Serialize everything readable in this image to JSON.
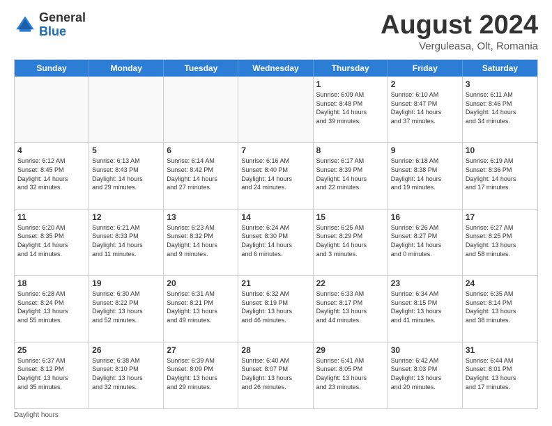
{
  "header": {
    "logo_general": "General",
    "logo_blue": "Blue",
    "month_title": "August 2024",
    "location": "Verguleasa, Olt, Romania"
  },
  "days_of_week": [
    "Sunday",
    "Monday",
    "Tuesday",
    "Wednesday",
    "Thursday",
    "Friday",
    "Saturday"
  ],
  "footer_note": "Daylight hours",
  "weeks": [
    [
      {
        "day": "",
        "info": "",
        "empty": true
      },
      {
        "day": "",
        "info": "",
        "empty": true
      },
      {
        "day": "",
        "info": "",
        "empty": true
      },
      {
        "day": "",
        "info": "",
        "empty": true
      },
      {
        "day": "1",
        "info": "Sunrise: 6:09 AM\nSunset: 8:48 PM\nDaylight: 14 hours\nand 39 minutes.",
        "empty": false
      },
      {
        "day": "2",
        "info": "Sunrise: 6:10 AM\nSunset: 8:47 PM\nDaylight: 14 hours\nand 37 minutes.",
        "empty": false
      },
      {
        "day": "3",
        "info": "Sunrise: 6:11 AM\nSunset: 8:46 PM\nDaylight: 14 hours\nand 34 minutes.",
        "empty": false
      }
    ],
    [
      {
        "day": "4",
        "info": "Sunrise: 6:12 AM\nSunset: 8:45 PM\nDaylight: 14 hours\nand 32 minutes.",
        "empty": false
      },
      {
        "day": "5",
        "info": "Sunrise: 6:13 AM\nSunset: 8:43 PM\nDaylight: 14 hours\nand 29 minutes.",
        "empty": false
      },
      {
        "day": "6",
        "info": "Sunrise: 6:14 AM\nSunset: 8:42 PM\nDaylight: 14 hours\nand 27 minutes.",
        "empty": false
      },
      {
        "day": "7",
        "info": "Sunrise: 6:16 AM\nSunset: 8:40 PM\nDaylight: 14 hours\nand 24 minutes.",
        "empty": false
      },
      {
        "day": "8",
        "info": "Sunrise: 6:17 AM\nSunset: 8:39 PM\nDaylight: 14 hours\nand 22 minutes.",
        "empty": false
      },
      {
        "day": "9",
        "info": "Sunrise: 6:18 AM\nSunset: 8:38 PM\nDaylight: 14 hours\nand 19 minutes.",
        "empty": false
      },
      {
        "day": "10",
        "info": "Sunrise: 6:19 AM\nSunset: 8:36 PM\nDaylight: 14 hours\nand 17 minutes.",
        "empty": false
      }
    ],
    [
      {
        "day": "11",
        "info": "Sunrise: 6:20 AM\nSunset: 8:35 PM\nDaylight: 14 hours\nand 14 minutes.",
        "empty": false
      },
      {
        "day": "12",
        "info": "Sunrise: 6:21 AM\nSunset: 8:33 PM\nDaylight: 14 hours\nand 11 minutes.",
        "empty": false
      },
      {
        "day": "13",
        "info": "Sunrise: 6:23 AM\nSunset: 8:32 PM\nDaylight: 14 hours\nand 9 minutes.",
        "empty": false
      },
      {
        "day": "14",
        "info": "Sunrise: 6:24 AM\nSunset: 8:30 PM\nDaylight: 14 hours\nand 6 minutes.",
        "empty": false
      },
      {
        "day": "15",
        "info": "Sunrise: 6:25 AM\nSunset: 8:29 PM\nDaylight: 14 hours\nand 3 minutes.",
        "empty": false
      },
      {
        "day": "16",
        "info": "Sunrise: 6:26 AM\nSunset: 8:27 PM\nDaylight: 14 hours\nand 0 minutes.",
        "empty": false
      },
      {
        "day": "17",
        "info": "Sunrise: 6:27 AM\nSunset: 8:25 PM\nDaylight: 13 hours\nand 58 minutes.",
        "empty": false
      }
    ],
    [
      {
        "day": "18",
        "info": "Sunrise: 6:28 AM\nSunset: 8:24 PM\nDaylight: 13 hours\nand 55 minutes.",
        "empty": false
      },
      {
        "day": "19",
        "info": "Sunrise: 6:30 AM\nSunset: 8:22 PM\nDaylight: 13 hours\nand 52 minutes.",
        "empty": false
      },
      {
        "day": "20",
        "info": "Sunrise: 6:31 AM\nSunset: 8:21 PM\nDaylight: 13 hours\nand 49 minutes.",
        "empty": false
      },
      {
        "day": "21",
        "info": "Sunrise: 6:32 AM\nSunset: 8:19 PM\nDaylight: 13 hours\nand 46 minutes.",
        "empty": false
      },
      {
        "day": "22",
        "info": "Sunrise: 6:33 AM\nSunset: 8:17 PM\nDaylight: 13 hours\nand 44 minutes.",
        "empty": false
      },
      {
        "day": "23",
        "info": "Sunrise: 6:34 AM\nSunset: 8:15 PM\nDaylight: 13 hours\nand 41 minutes.",
        "empty": false
      },
      {
        "day": "24",
        "info": "Sunrise: 6:35 AM\nSunset: 8:14 PM\nDaylight: 13 hours\nand 38 minutes.",
        "empty": false
      }
    ],
    [
      {
        "day": "25",
        "info": "Sunrise: 6:37 AM\nSunset: 8:12 PM\nDaylight: 13 hours\nand 35 minutes.",
        "empty": false
      },
      {
        "day": "26",
        "info": "Sunrise: 6:38 AM\nSunset: 8:10 PM\nDaylight: 13 hours\nand 32 minutes.",
        "empty": false
      },
      {
        "day": "27",
        "info": "Sunrise: 6:39 AM\nSunset: 8:09 PM\nDaylight: 13 hours\nand 29 minutes.",
        "empty": false
      },
      {
        "day": "28",
        "info": "Sunrise: 6:40 AM\nSunset: 8:07 PM\nDaylight: 13 hours\nand 26 minutes.",
        "empty": false
      },
      {
        "day": "29",
        "info": "Sunrise: 6:41 AM\nSunset: 8:05 PM\nDaylight: 13 hours\nand 23 minutes.",
        "empty": false
      },
      {
        "day": "30",
        "info": "Sunrise: 6:42 AM\nSunset: 8:03 PM\nDaylight: 13 hours\nand 20 minutes.",
        "empty": false
      },
      {
        "day": "31",
        "info": "Sunrise: 6:44 AM\nSunset: 8:01 PM\nDaylight: 13 hours\nand 17 minutes.",
        "empty": false
      }
    ]
  ]
}
